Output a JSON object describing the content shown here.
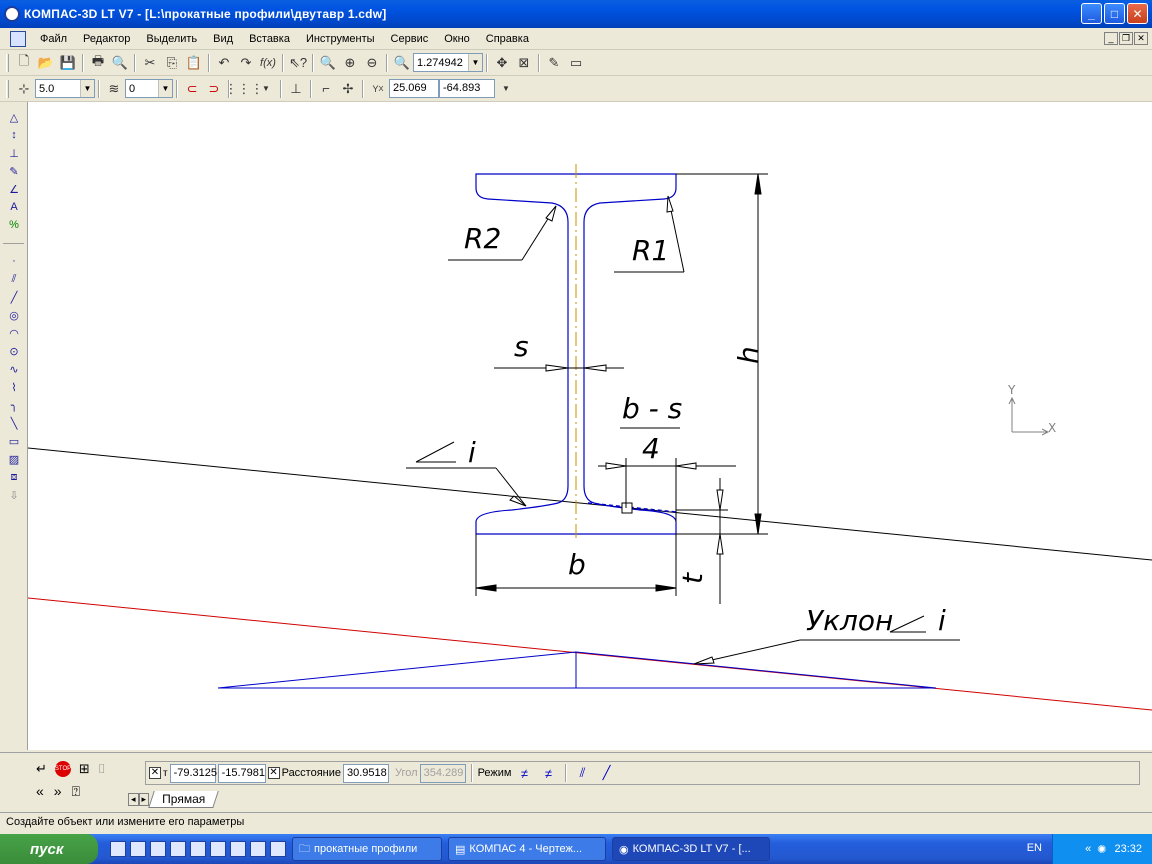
{
  "window": {
    "title": "КОМПАС-3D LT V7 - [L:\\прокатные профили\\двутавр 1.cdw]",
    "minimize": "_",
    "maximize": "□",
    "close": "✕"
  },
  "menu": [
    "Файл",
    "Редактор",
    "Выделить",
    "Вид",
    "Вставка",
    "Инструменты",
    "Сервис",
    "Окно",
    "Справка"
  ],
  "toolbar": {
    "zoom_value": "1.274942"
  },
  "toolbar2": {
    "step_value": "5.0",
    "layer_value": "0",
    "coord_y": "25.069",
    "coord_x": "-64.893"
  },
  "drawing": {
    "labels": {
      "r2": "R2",
      "r1": "R1",
      "s": "s",
      "h": "h",
      "b_minus_s": "b - s",
      "four": "4",
      "angle_i": "i",
      "b": "b",
      "t": "t",
      "slope": "Уклон",
      "slope_i": "i",
      "axis_y": "Y",
      "axis_x": "X"
    }
  },
  "props": {
    "t1_x": "-79.3125",
    "t1_y": "-15.7981",
    "distance_label": "Расстояние",
    "distance_value": "30.9518",
    "angle_label": "Угол",
    "angle_value": "354.289",
    "mode_label": "Режим",
    "tab_label": "Прямая"
  },
  "status": {
    "text": "Создайте объект или измените его параметры"
  },
  "taskbar": {
    "start": "пуск",
    "tasks": [
      "прокатные профили",
      "КОМПАС 4 - Чертеж...",
      "КОМПАС-3D LT V7 - [..."
    ],
    "lang": "EN",
    "clock": "23:32"
  }
}
